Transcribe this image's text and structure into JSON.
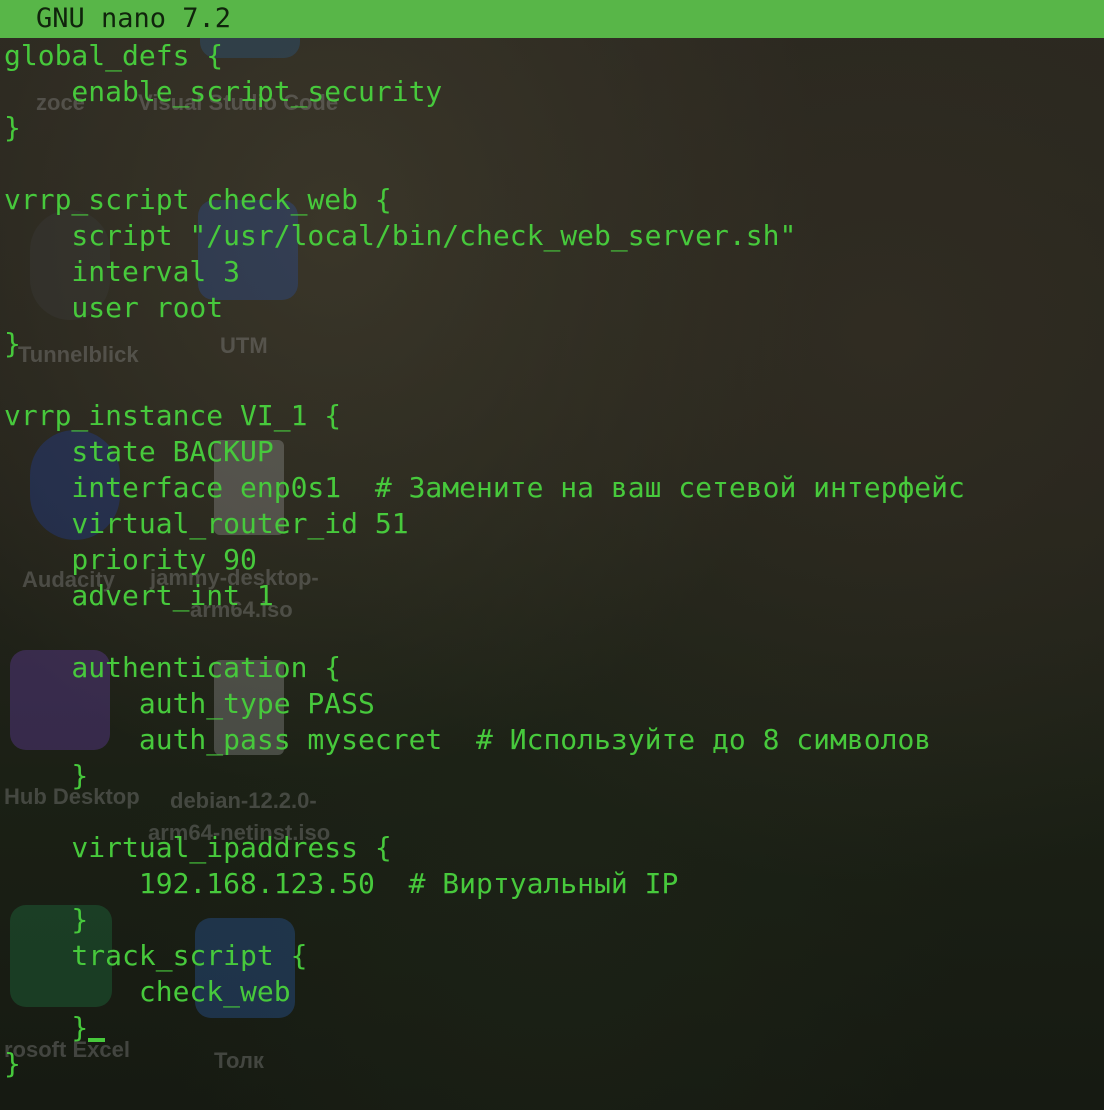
{
  "app": {
    "title": "GNU nano 7.2"
  },
  "colors": {
    "titlebar_bg": "#58b648",
    "text": "#47c93c",
    "background": "#1f1e16"
  },
  "desktop": {
    "labels": [
      "zoce",
      "Visual Studio Code",
      "Tunnelblick",
      "UTM",
      "Audacity",
      "jammy-desktop-",
      "arm64.iso",
      "Hub Desktop",
      "debian-12.2.0-",
      "arm64-netinst.iso",
      "rosoft Excel",
      "Толк"
    ]
  },
  "file": {
    "lines": [
      "global_defs {",
      "    enable_script_security",
      "}",
      "",
      "vrrp_script check_web {",
      "    script \"/usr/local/bin/check_web_server.sh\"",
      "    interval 3",
      "    user root",
      "}",
      "",
      "vrrp_instance VI_1 {",
      "    state BACKUP",
      "    interface enp0s1  # Замените на ваш сетевой интерфейс",
      "    virtual_router_id 51",
      "    priority 90",
      "    advert_int 1",
      "",
      "    authentication {",
      "        auth_type PASS",
      "        auth_pass mysecret  # Используйте до 8 символов",
      "    }",
      "",
      "    virtual_ipaddress {",
      "        192.168.123.50  # Виртуальный IP",
      "    }",
      "    track_script {",
      "        check_web",
      "    }",
      "}"
    ]
  }
}
